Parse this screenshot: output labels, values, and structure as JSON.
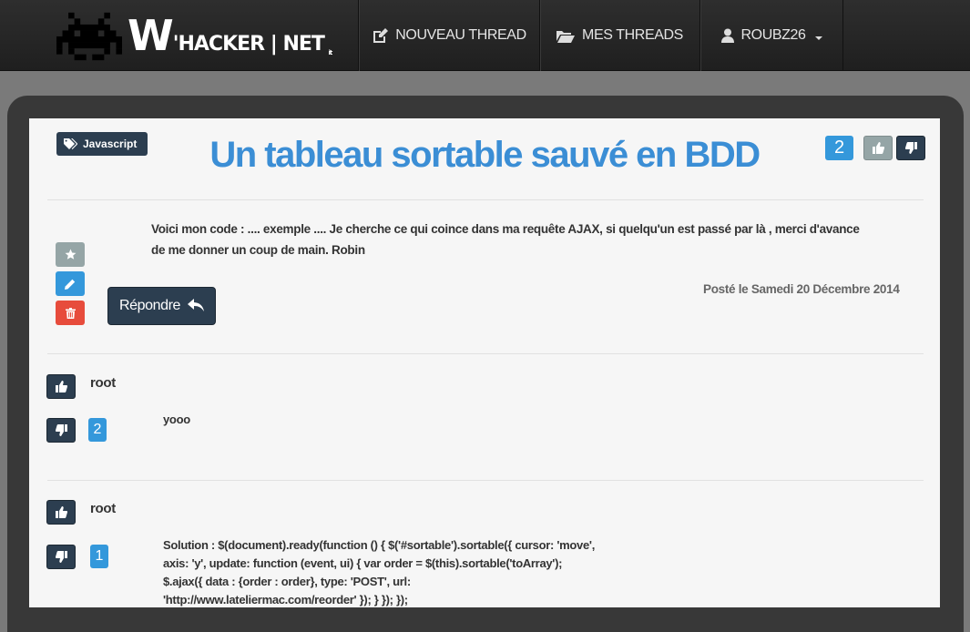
{
  "nav": {
    "logo": {
      "part1": "W",
      "part2": "'HACKER | NET",
      "part3": "it"
    },
    "items": [
      {
        "label": "NOUVEAU THREAD"
      },
      {
        "label": "MES THREADS"
      },
      {
        "label": "ROUBZ26"
      }
    ]
  },
  "thread": {
    "tag": "Javascript",
    "title": "Un tableau sortable sauvé en BDD",
    "score": "2",
    "body": "Voici mon code : .... exemple .... Je cherche ce qui coince dans ma requête AJAX, si quelqu'un est passé par là , merci d'avance de me donner un coup de main. Robin",
    "date": "Posté le Samedi 20 Décembre 2014",
    "reply_label": "Répondre"
  },
  "replies": [
    {
      "author": "root",
      "score": "2",
      "text": "yooo"
    },
    {
      "author": "root",
      "score": "1",
      "text": "Solution : $(document).ready(function () { $('#sortable').sortable({ cursor: 'move', axis: 'y', update: function (event, ui) { var order = $(this).sortable('toArray'); $.ajax({ data : {order : order}, type: 'POST', url: 'http://www.lateliermac.com/reorder' }); } }); });"
    }
  ],
  "icons": {
    "logo": "space-invader-icon",
    "new_thread": "pencil-square-icon",
    "my_threads": "folder-open-icon",
    "user": "user-icon",
    "tag": "tags-icon",
    "thumb_up": "thumbs-up-icon",
    "thumb_down": "thumbs-down-icon",
    "star": "star-icon",
    "edit": "pencil-icon",
    "trash": "trash-icon",
    "reply": "reply-icon"
  },
  "colors": {
    "title": "#3b8ed5",
    "dark": "#2c3e50",
    "blue": "#3498db",
    "gray": "#95a5a6",
    "red": "#e74c3c"
  }
}
